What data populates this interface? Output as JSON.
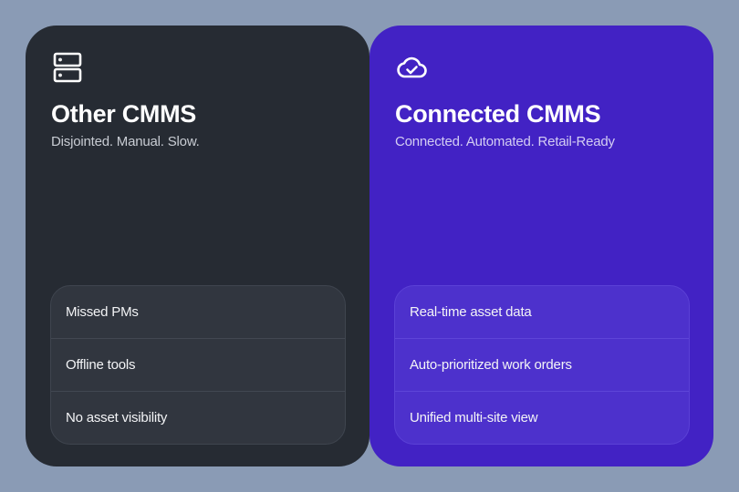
{
  "colors": {
    "background": "#8a9bb5",
    "left_card": "#262b33",
    "right_card": "#4222c4"
  },
  "left": {
    "icon": "server-icon",
    "title": "Other CMMS",
    "subtitle": "Disjointed. Manual. Slow.",
    "items": [
      {
        "label": "Missed PMs"
      },
      {
        "label": "Offline tools"
      },
      {
        "label": "No asset visibility"
      }
    ]
  },
  "right": {
    "icon": "cloud-check-icon",
    "title": "Connected CMMS",
    "subtitle": "Connected. Automated. Retail-Ready",
    "items": [
      {
        "label": "Real-time asset data"
      },
      {
        "label": "Auto-prioritized work orders"
      },
      {
        "label": "Unified multi-site view"
      }
    ]
  }
}
